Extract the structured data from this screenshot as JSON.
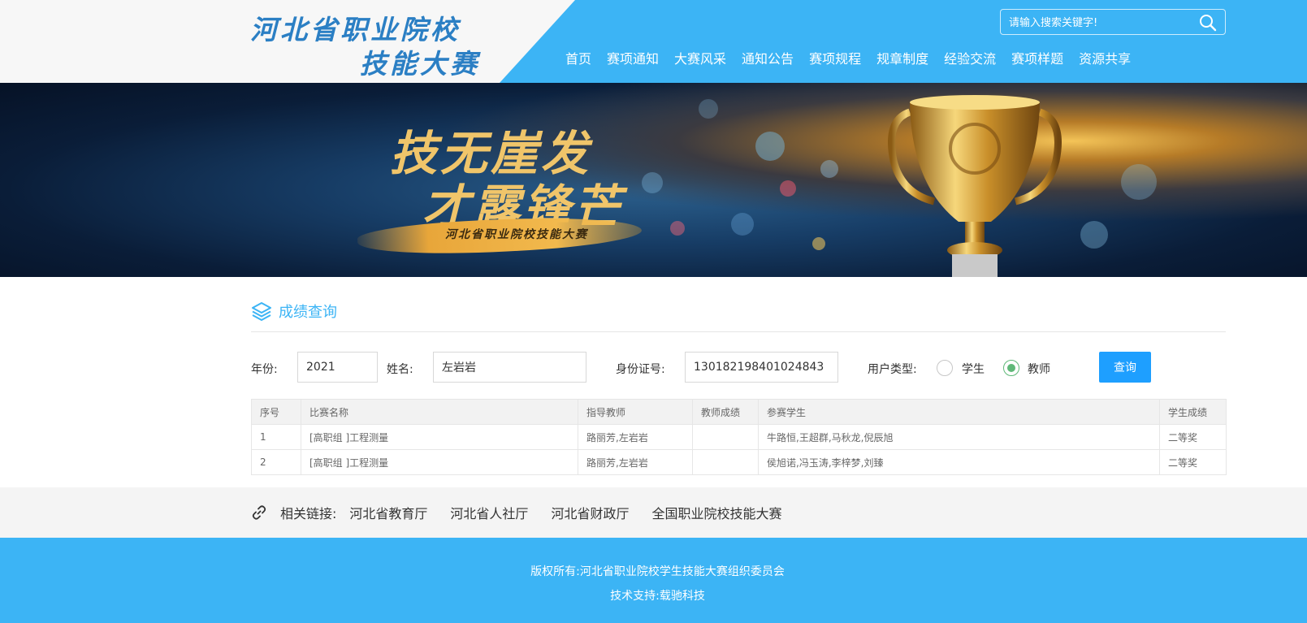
{
  "header": {
    "logo_line1": "河北省职业院校",
    "logo_line2": "技能大赛",
    "search_placeholder": "请输入搜索关键字!",
    "nav": [
      "首页",
      "赛项通知",
      "大赛风采",
      "通知公告",
      "赛项规程",
      "规章制度",
      "经验交流",
      "赛项样题",
      "资源共享"
    ]
  },
  "banner": {
    "slogan_line1": "技无崖发",
    "slogan_line2": "才露锋芒",
    "subtitle": "河北省职业院校技能大赛"
  },
  "section": {
    "title": "成绩查询"
  },
  "form": {
    "year_label": "年份:",
    "year_value": "2021",
    "name_label": "姓名:",
    "name_value": "左岩岩",
    "id_label": "身份证号:",
    "id_value": "130182198401024843",
    "user_type_label": "用户类型:",
    "options": [
      "学生",
      "教师"
    ],
    "selected_option": "教师",
    "query_button": "查询"
  },
  "table": {
    "headers": [
      "序号",
      "比赛名称",
      "指导教师",
      "教师成绩",
      "参赛学生",
      "学生成绩"
    ],
    "rows": [
      [
        "1",
        "[高职组 ]工程测量",
        "路丽芳,左岩岩",
        "",
        "牛路恒,王超群,马秋龙,倪辰旭",
        "二等奖"
      ],
      [
        "2",
        "[高职组 ]工程测量",
        "路丽芳,左岩岩",
        "",
        "侯旭诺,冯玉涛,李梓梦,刘臻",
        "二等奖"
      ]
    ]
  },
  "links": {
    "label": "相关链接:",
    "items": [
      "河北省教育厅",
      "河北省人社厅",
      "河北省财政厅",
      "全国职业院校技能大赛"
    ]
  },
  "footer": {
    "copyright_label": "版权所有:",
    "copyright_value": "河北省职业院校学生技能大赛组织委员会",
    "support_label": "技术支持:",
    "support_value": "载驰科技"
  },
  "colors": {
    "primary": "#3cb4f5",
    "button": "#1e9fff",
    "radio_checked": "#5fb878",
    "logo": "#2b7fc4"
  }
}
